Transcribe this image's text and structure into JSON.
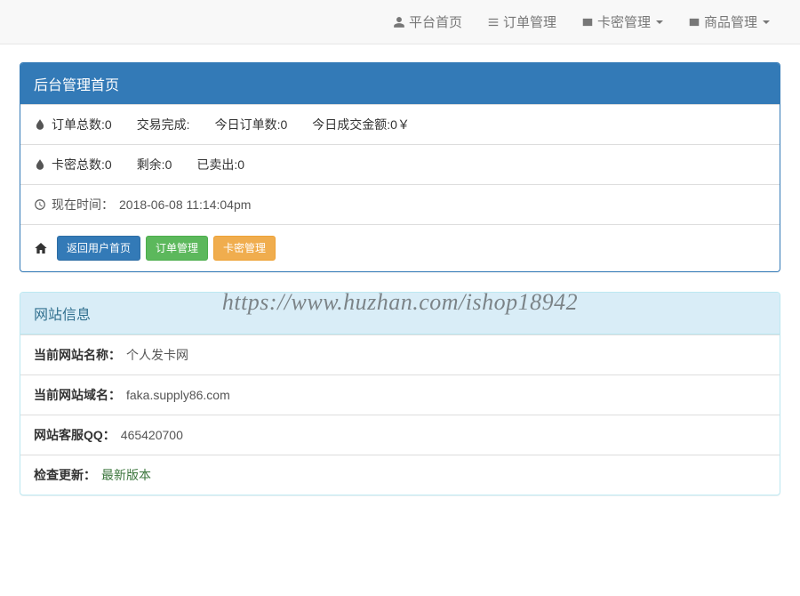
{
  "nav": {
    "home": "平台首页",
    "orders": "订单管理",
    "cards": "卡密管理",
    "goods": "商品管理"
  },
  "dashboard": {
    "title": "后台管理首页",
    "stats_row1": {
      "total_orders_label": "订单总数:",
      "total_orders_value": "0",
      "completed_label": "交易完成:",
      "completed_value": "",
      "today_orders_label": "今日订单数:",
      "today_orders_value": "0",
      "today_amount_label": "今日成交金额:",
      "today_amount_value": "0￥"
    },
    "stats_row2": {
      "total_cards_label": "卡密总数:",
      "total_cards_value": "0",
      "remaining_label": "剩余:",
      "remaining_value": "0",
      "sold_label": "已卖出:",
      "sold_value": "0"
    },
    "time_row": {
      "label": "现在时间：",
      "value": "2018-06-08 11:14:04pm"
    },
    "buttons": {
      "back_home": "返回用户首页",
      "order_mgmt": "订单管理",
      "card_mgmt": "卡密管理"
    }
  },
  "siteinfo": {
    "title": "网站信息",
    "name_label": "当前网站名称：",
    "name_value": "个人发卡网",
    "domain_label": "当前网站域名：",
    "domain_value": "faka.supply86.com",
    "qq_label": "网站客服QQ：",
    "qq_value": "465420700",
    "update_label": "检查更新：",
    "update_value": "最新版本"
  },
  "watermark": "https://www.huzhan.com/ishop18942"
}
